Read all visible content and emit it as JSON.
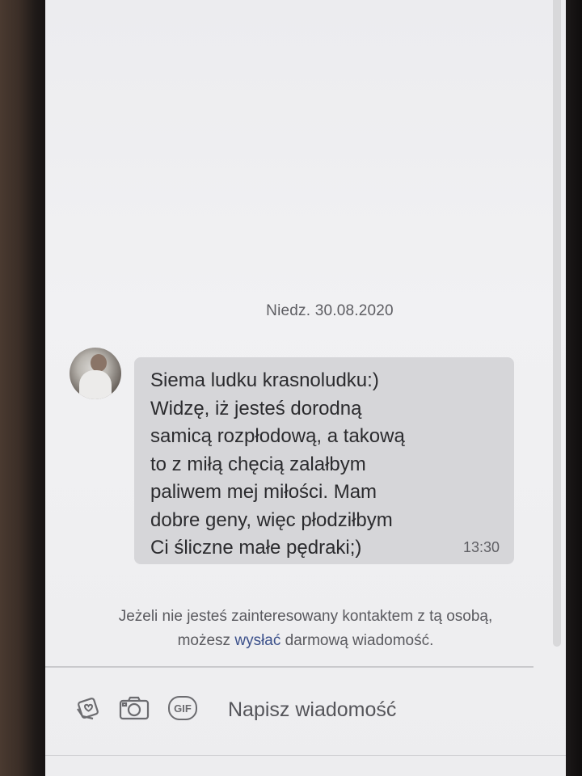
{
  "conversation": {
    "date_label": "Niedz. 30.08.2020",
    "message": {
      "lines": [
        "Siema ludku krasnoludku:)",
        "Widzę, iż jesteś dorodną",
        "samicą rozpłodową, a takową",
        "to z miłą chęcią zalałbym",
        "paliwem mej miłości. Mam",
        "dobre geny, więc płodziłbym",
        "Ci śliczne małe pędraki;)"
      ],
      "time": "13:30"
    }
  },
  "notice": {
    "line1": "Jeżeli nie jesteś zainteresowany kontaktem z tą osobą,",
    "line2_before": "możesz ",
    "line2_link": "wysłać",
    "line2_after": " darmową wiadomość."
  },
  "composer": {
    "gif_label": "GIF",
    "placeholder": "Napisz wiadomość"
  },
  "icons": {
    "sticker": "sticker-icon",
    "camera": "camera-icon",
    "gif": "gif-icon"
  }
}
